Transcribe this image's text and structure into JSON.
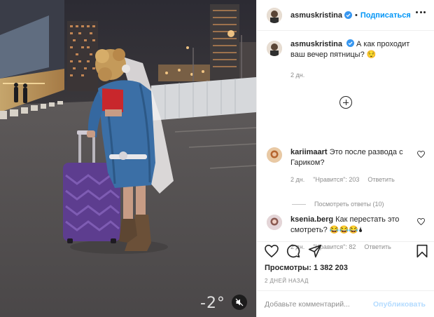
{
  "post": {
    "temperature_overlay": "-2°",
    "author": {
      "username": "asmuskristina",
      "verified": true,
      "follow_label": "Подписаться",
      "dot": "•"
    },
    "caption": {
      "username": "asmuskristina",
      "text": "А как проходит ваш вечер пятницы? 😌",
      "time": "2 дн."
    },
    "comments": [
      {
        "username": "kariimaart",
        "text": "Это после развода с Гариком?",
        "time": "2 дн.",
        "likes": "\"Нравится\": 203",
        "reply_label": "Ответить",
        "view_replies": "Посмотреть ответы (10)"
      },
      {
        "username": "ksenia.berg",
        "text": "Как перестать это смотреть? 😂😂😂🌢",
        "time": "2 дн.",
        "likes": "\"Нравится\": 82",
        "reply_label": "Ответить"
      }
    ],
    "views_label": "Просмотры: 1 382 203",
    "posted_ago": "2 ДНЕЙ НАЗАД",
    "comment_input_placeholder": "Добавьте комментарий...",
    "publish_label": "Опубликовать",
    "icons": [
      "mute-icon",
      "more-icon",
      "verified-icon",
      "plus-icon",
      "heart-icon",
      "comment-icon",
      "share-icon",
      "bookmark-icon"
    ],
    "colors": {
      "accent": "#0095f6",
      "publish_disabled": "#b3dbff",
      "text": "#262626",
      "muted": "#8e8e8e"
    }
  }
}
